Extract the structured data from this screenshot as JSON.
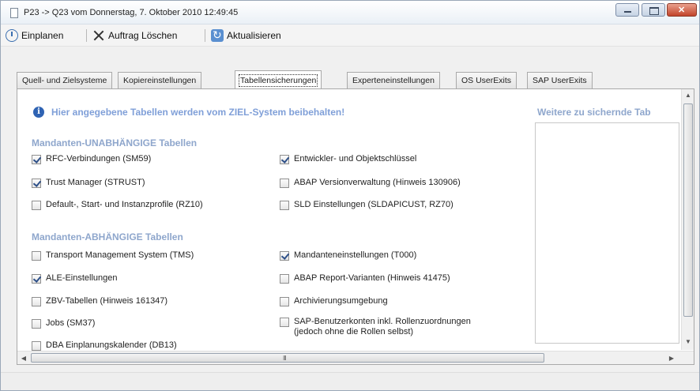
{
  "window": {
    "title": "P23 -> Q23 vom Donnerstag, 7. Oktober 2010 12:49:45"
  },
  "toolbar": {
    "schedule_label": "Einplanen",
    "delete_label": "Auftrag Löschen",
    "refresh_label": "Aktualisieren"
  },
  "tabs": [
    {
      "label": "Quell- und Zielsysteme"
    },
    {
      "label": "Kopiereinstellungen"
    },
    {
      "label": "Tabellensicherungen"
    },
    {
      "label": "Experteneinstellungen"
    },
    {
      "label": "OS UserExits"
    },
    {
      "label": "SAP UserExits"
    }
  ],
  "active_tab": "Tabellensicherungen",
  "panel": {
    "info_text": "Hier angegebene Tabellen werden vom ZIEL-System beibehalten!",
    "right_title": "Weitere zu sichernde Tab",
    "independent": {
      "heading": "Mandanten-UNABHÄNGIGE Tabellen",
      "items": [
        {
          "label": "RFC-Verbindungen (SM59)",
          "checked": true
        },
        {
          "label": "Entwickler- und Objektschlüssel",
          "checked": true
        },
        {
          "label": "Trust Manager (STRUST)",
          "checked": true
        },
        {
          "label": "ABAP Versionverwaltung (Hinweis 130906)",
          "checked": false
        },
        {
          "label": "Default-, Start- und Instanzprofile (RZ10)",
          "checked": false
        },
        {
          "label": "SLD Einstellungen (SLDAPICUST, RZ70)",
          "checked": false
        }
      ]
    },
    "dependent": {
      "heading": "Mandanten-ABHÄNGIGE Tabellen",
      "items": [
        {
          "label": "Transport Management System (TMS)",
          "checked": false
        },
        {
          "label": "Mandanteneinstellungen (T000)",
          "checked": true
        },
        {
          "label": "ALE-Einstellungen",
          "checked": true
        },
        {
          "label": "ABAP Report-Varianten (Hinweis 41475)",
          "checked": false
        },
        {
          "label": "ZBV-Tabellen (Hinweis 161347)",
          "checked": false
        },
        {
          "label": "Archivierungsumgebung",
          "checked": false
        },
        {
          "label": "Jobs (SM37)",
          "checked": false
        },
        {
          "label": "SAP-Benutzerkonten inkl. Rollenzuordnungen",
          "label_line2": "(jedoch ohne die Rollen selbst)",
          "checked": false
        },
        {
          "label": "DBA Einplanungskalender (DB13)",
          "checked": false
        }
      ]
    },
    "hscroll_grip": "III"
  }
}
